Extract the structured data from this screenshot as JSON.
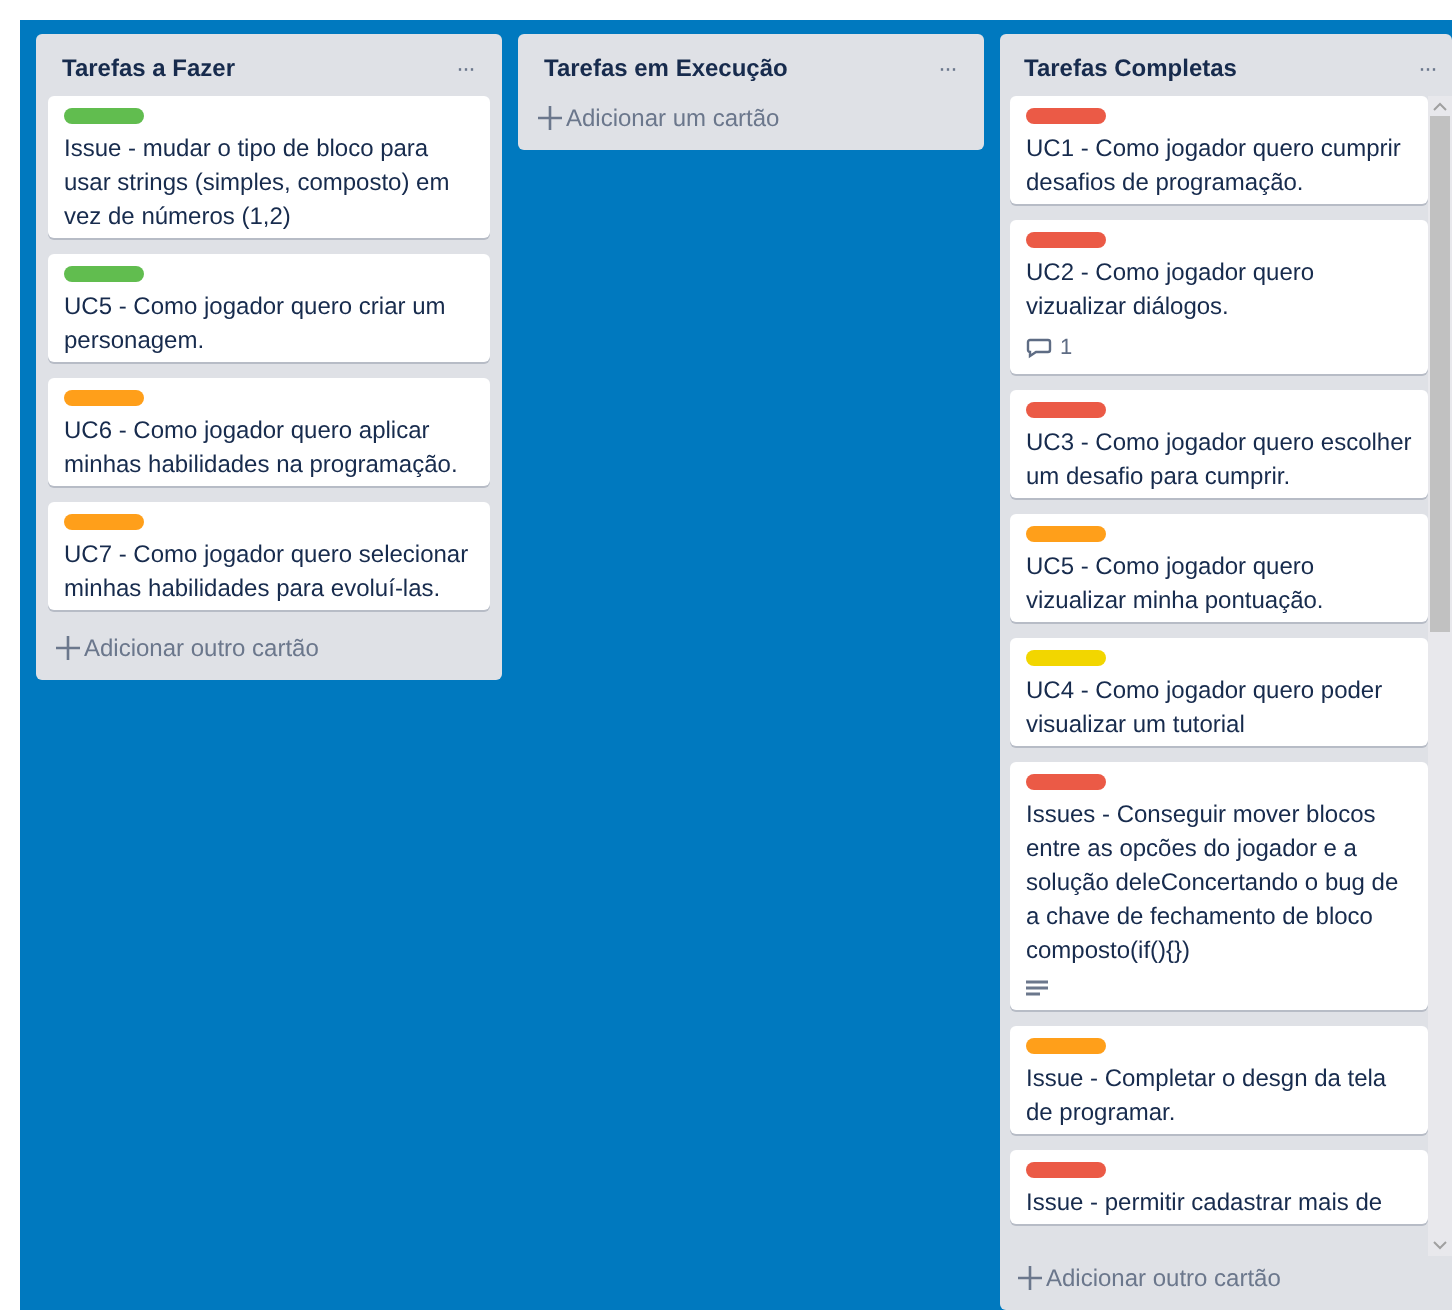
{
  "lists": [
    {
      "title": "Tarefas a Fazer",
      "menu": "···",
      "scrollbar": false,
      "cards": [
        {
          "color": "#61bd4f",
          "text": "Issue - mudar o tipo de bloco para usar strings (simples, composto) em vez de números (1,2)"
        },
        {
          "color": "#61bd4f",
          "text": "UC5 - Como jogador quero criar um personagem."
        },
        {
          "color": "#ff9f1a",
          "text": "UC6 - Como jogador quero aplicar minhas habilidades na programação."
        },
        {
          "color": "#ff9f1a",
          "text": "UC7 - Como jogador quero selecionar minhas habilidades para evoluí-las."
        }
      ],
      "add": "Adicionar outro cartão"
    },
    {
      "title": "Tarefas em Execução",
      "menu": "···",
      "scrollbar": false,
      "add": "Adicionar um cartão"
    },
    {
      "title": "Tarefas Completas",
      "menu": "···",
      "scrollbar": true,
      "cards": [
        {
          "color": "#eb5a46",
          "text": "UC1 - Como jogador quero cumprir desafios de programação."
        },
        {
          "color": "#eb5a46",
          "text": "UC2 - Como jogador quero vizualizar diálogos.",
          "comments": "1"
        },
        {
          "color": "#eb5a46",
          "text": "UC3 - Como jogador quero escolher um desafio para cumprir."
        },
        {
          "color": "#ff9f1a",
          "text": "UC5 - Como jogador quero vizualizar minha pontuação."
        },
        {
          "color": "#f2d600",
          "text": "UC4 - Como jogador quero poder visualizar um tutorial"
        },
        {
          "color": "#eb5a46",
          "text": "Issues - Conseguir mover blocos entre as opcões do jogador e a solução deleConcertando o bug de a chave de fechamento de bloco composto(if(){})",
          "has_description": true
        },
        {
          "color": "#ff9f1a",
          "text": "Issue - Completar o desgn da tela de programar."
        },
        {
          "color": "#eb5a46",
          "text": "Issue - permitir cadastrar mais de"
        }
      ],
      "add": "Adicionar outro cartão"
    }
  ]
}
